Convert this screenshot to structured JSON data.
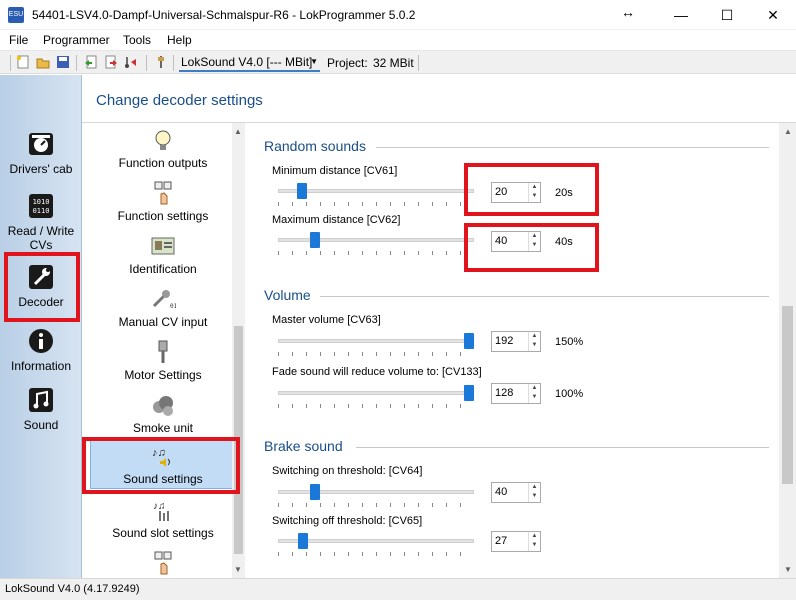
{
  "window": {
    "title": "54401-LSV4.0-Dampf-Universal-Schmalspur-R6 - LokProgrammer 5.0.2",
    "app_icon_text": "ESU",
    "resize_glyph": "↔",
    "minimize": "—",
    "maximize": "☐",
    "close": "✕"
  },
  "menu": [
    "File",
    "Programmer",
    "Tools",
    "Help"
  ],
  "toolbar": {
    "decoder": "LokSound V4.0 [--- MBit]",
    "project_label": "Project:",
    "project_size": "32 MBit"
  },
  "leftnav": [
    {
      "label": "Drivers' cab",
      "icon": "drivers-cab-icon"
    },
    {
      "label": "Read / Write CVs",
      "icon": "read-write-cvs-icon"
    },
    {
      "label": "Decoder",
      "icon": "wrench-icon",
      "highlighted": true
    },
    {
      "label": "Information",
      "icon": "info-icon"
    },
    {
      "label": "Sound",
      "icon": "music-note-icon"
    }
  ],
  "header": {
    "title": "Change decoder settings"
  },
  "categories": [
    {
      "label": "Function outputs",
      "icon": "light-bulb-icon"
    },
    {
      "label": "Function settings",
      "icon": "function-keys-icon"
    },
    {
      "label": "Identification",
      "icon": "id-card-icon"
    },
    {
      "label": "Manual CV input",
      "icon": "wrench-cv-icon"
    },
    {
      "label": "Motor Settings",
      "icon": "piston-icon"
    },
    {
      "label": "Smoke unit",
      "icon": "smoke-icon"
    },
    {
      "label": "Sound settings",
      "icon": "sound-settings-icon",
      "selected": true
    },
    {
      "label": "Sound slot settings",
      "icon": "sound-slot-icon"
    }
  ],
  "sections": {
    "random": {
      "title": "Random sounds",
      "params": [
        {
          "label": "Minimum distance [CV61]",
          "value": "20",
          "unit": "20s",
          "fraction": 0.1
        },
        {
          "label": "Maximum distance [CV62]",
          "value": "40",
          "unit": "40s",
          "fraction": 0.17
        }
      ]
    },
    "volume": {
      "title": "Volume",
      "params": [
        {
          "label": "Master volume [CV63]",
          "value": "192",
          "unit": "150%",
          "fraction": 1.0
        },
        {
          "label": "Fade sound will reduce volume to:  [CV133]",
          "value": "128",
          "unit": "100%",
          "fraction": 1.0
        }
      ]
    },
    "brake": {
      "title": "Brake sound",
      "params": [
        {
          "label": "Switching on threshold: [CV64]",
          "value": "40",
          "unit": "",
          "fraction": 0.17
        },
        {
          "label": "Switching off threshold: [CV65]",
          "value": "27",
          "unit": "",
          "fraction": 0.11
        }
      ]
    }
  },
  "status": {
    "text": "LokSound V4.0 (4.17.9249)"
  },
  "colors": {
    "accent": "#1a78d8",
    "highlight": "#e0141c",
    "section_title": "#1a4e8a"
  }
}
